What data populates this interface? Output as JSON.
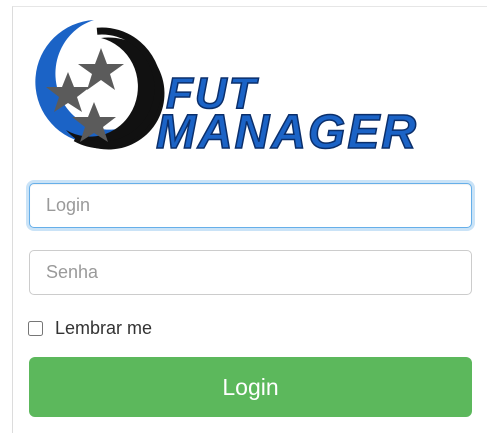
{
  "logo": {
    "line1": "FUT",
    "line2": "MANAGER",
    "colors": {
      "blue": "#1b63c6",
      "black": "#111111",
      "star": "#5b5b5b"
    }
  },
  "form": {
    "login": {
      "placeholder": "Login",
      "value": ""
    },
    "password": {
      "placeholder": "Senha",
      "value": ""
    },
    "remember": {
      "label": "Lembrar me",
      "checked": false
    },
    "submit": {
      "label": "Login",
      "color": "#5cb85c"
    }
  }
}
